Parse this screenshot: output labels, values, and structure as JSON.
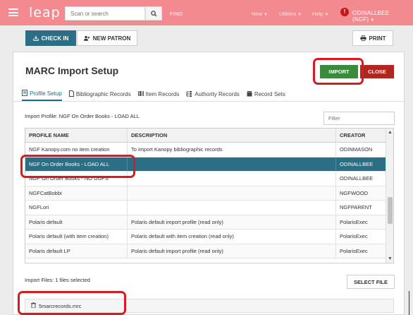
{
  "topbar": {
    "logo": "leap",
    "search_placeholder": "Scan or search",
    "find_label": "FIND",
    "menus": [
      {
        "label": "New"
      },
      {
        "label": "Utilities"
      },
      {
        "label": "Help"
      }
    ],
    "user_label": "ODINALLBEE (NGF)",
    "alert_glyph": "!"
  },
  "toolbar": {
    "checkin_label": "CHECK IN",
    "newpatron_label": "NEW PATRON",
    "print_label": "PRINT"
  },
  "panel": {
    "title": "MARC Import Setup",
    "import_label": "IMPORT",
    "close_label": "CLOSE",
    "tabs": [
      {
        "label": "Profile Setup",
        "icon": "profile-icon",
        "active": true
      },
      {
        "label": "Bibliographic Records",
        "icon": "document-icon",
        "active": false
      },
      {
        "label": "Item Records",
        "icon": "barcode-icon",
        "active": false
      },
      {
        "label": "Authority Records",
        "icon": "tree-icon",
        "active": false
      },
      {
        "label": "Record Sets",
        "icon": "record-sets-icon",
        "active": false
      }
    ],
    "import_profile": "Import Profile: NGF On Order Books - LOAD ALL",
    "filter_placeholder": "Filter",
    "table": {
      "headers": [
        "PROFILE NAME",
        "DESCRIPTION",
        "CREATOR"
      ],
      "rows": [
        {
          "name": "NGF Kanopy.com no item creation",
          "description": "To import Kanopy bibliographic records",
          "creator": "ODINMASON",
          "selected": false
        },
        {
          "name": "NGF On Order Books - LOAD ALL",
          "description": "",
          "creator": "ODINALLBEE",
          "selected": true
        },
        {
          "name": "NGF On Order Books - NO DUPS",
          "description": "",
          "creator": "ODINALLBEE",
          "selected": false
        },
        {
          "name": "NGFCatBobbi",
          "description": "",
          "creator": "NGFWOOD",
          "selected": false
        },
        {
          "name": "NGFLori",
          "description": "",
          "creator": "NGFPARENT",
          "selected": false
        },
        {
          "name": "Polaris default",
          "description": "Polaris default import profile (read only)",
          "creator": "PolarisExec",
          "selected": false
        },
        {
          "name": "Polaris default (with item creation)",
          "description": "Polaris default with item creation (read only)",
          "creator": "PolarisExec",
          "selected": false
        },
        {
          "name": "Polaris default LP",
          "description": "Polaris default import profile (read only)",
          "creator": "PolarisExec",
          "selected": false
        }
      ]
    },
    "import_files": "Import Files: 1 files selected",
    "select_file_label": "SELECT FILE",
    "file_name": "5marcrecords.mrc"
  },
  "colors": {
    "topbar": "#f38a90",
    "accent": "#2b6f86",
    "import": "#3b8c3a",
    "close": "#b3261e",
    "highlight": "#d91a22"
  }
}
